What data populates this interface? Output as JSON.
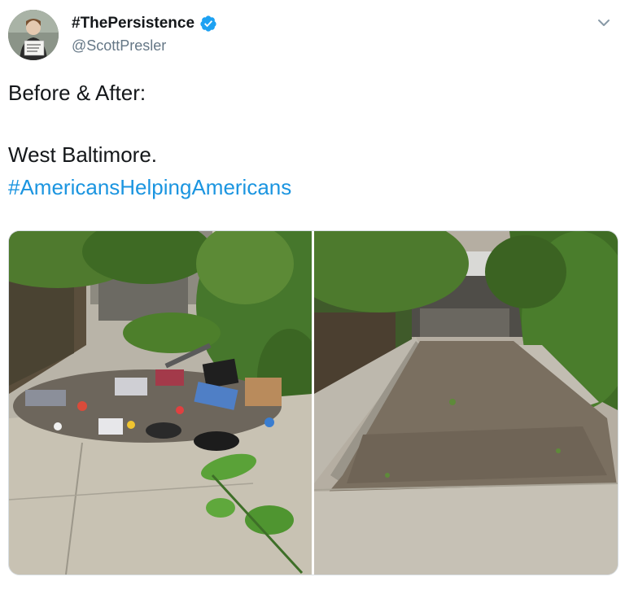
{
  "tweet": {
    "display_name": "#ThePersistence",
    "handle": "@ScottPresler",
    "verified": true,
    "text_lines": [
      "Before & After:",
      "West Baltimore."
    ],
    "hashtag": "#AmericansHelpingAmericans"
  },
  "colors": {
    "link": "#1b95e0",
    "verified": "#1da1f2",
    "handle": "#657786",
    "text": "#14171a"
  },
  "icons": {
    "verified": "verified-badge-icon",
    "menu": "chevron-down-icon"
  }
}
